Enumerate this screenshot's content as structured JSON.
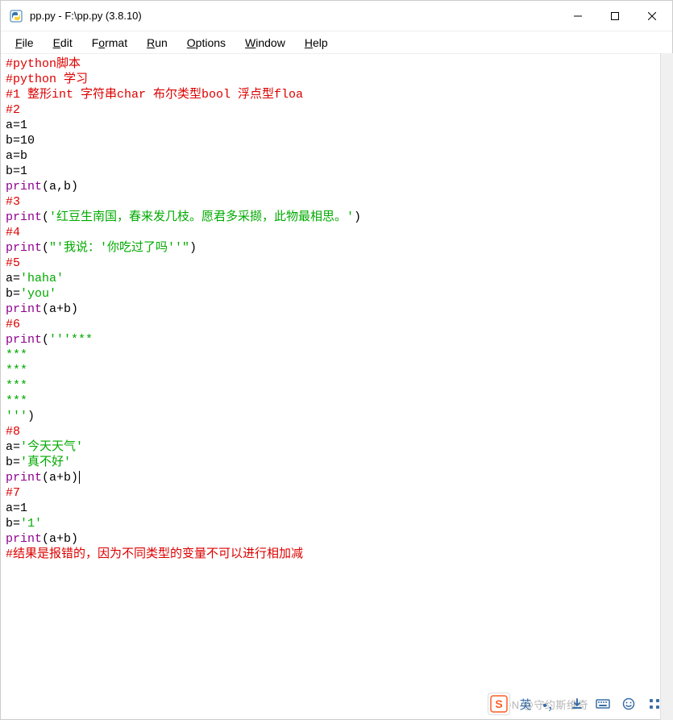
{
  "window": {
    "title": "pp.py - F:\\pp.py (3.8.10)"
  },
  "menu": {
    "file": "File",
    "edit": "Edit",
    "format": "Format",
    "run": "Run",
    "options": "Options",
    "window": "Window",
    "help": "Help"
  },
  "code": {
    "l1": "#python脚本",
    "l2": "#python 学习",
    "l3": "#1 整形int 字符串char 布尔类型bool 浮点型floa",
    "l4": "#2",
    "l5": "a=1",
    "l6": "b=10",
    "l7": "a=b",
    "l8": "b=1",
    "l9a": "print",
    "l9b": "(a,b)",
    "l10": "#3",
    "l11a": "print",
    "l11b": "(",
    "l11c": "'红豆生南国，春来发几枝。愿君多采撷，此物最相思。'",
    "l11d": ")",
    "l12": "#4",
    "l13a": "print",
    "l13b": "(",
    "l13c": "\"'我说：'你吃过了吗''\"",
    "l13d": ")",
    "l14": "#5",
    "l15a": "a=",
    "l15b": "'haha'",
    "l16a": "b=",
    "l16b": "'you'",
    "l17a": "print",
    "l17b": "(a+b)",
    "l18": "#6",
    "l19a": "print",
    "l19b": "(",
    "l19c": "'''***",
    "l20": "***",
    "l21": "***",
    "l22": "***",
    "l23": "***",
    "l24a": "'''",
    "l24b": ")",
    "l25": "#8",
    "l26a": "a=",
    "l26b": "'今天天气'",
    "l27a": "b=",
    "l27b": "'真不好'",
    "l28a": "print",
    "l28b": "(a+b)",
    "l29": "#7",
    "l30": "a=1",
    "l31a": "b=",
    "l31b": "'1'",
    "l32a": "print",
    "l32b": "(a+b)",
    "l33": "#结果是报错的，因为不同类型的变量不可以进行相加减"
  },
  "tray": {
    "ime_char": "英",
    "watermark": "CSDN @守约斯维奇"
  }
}
